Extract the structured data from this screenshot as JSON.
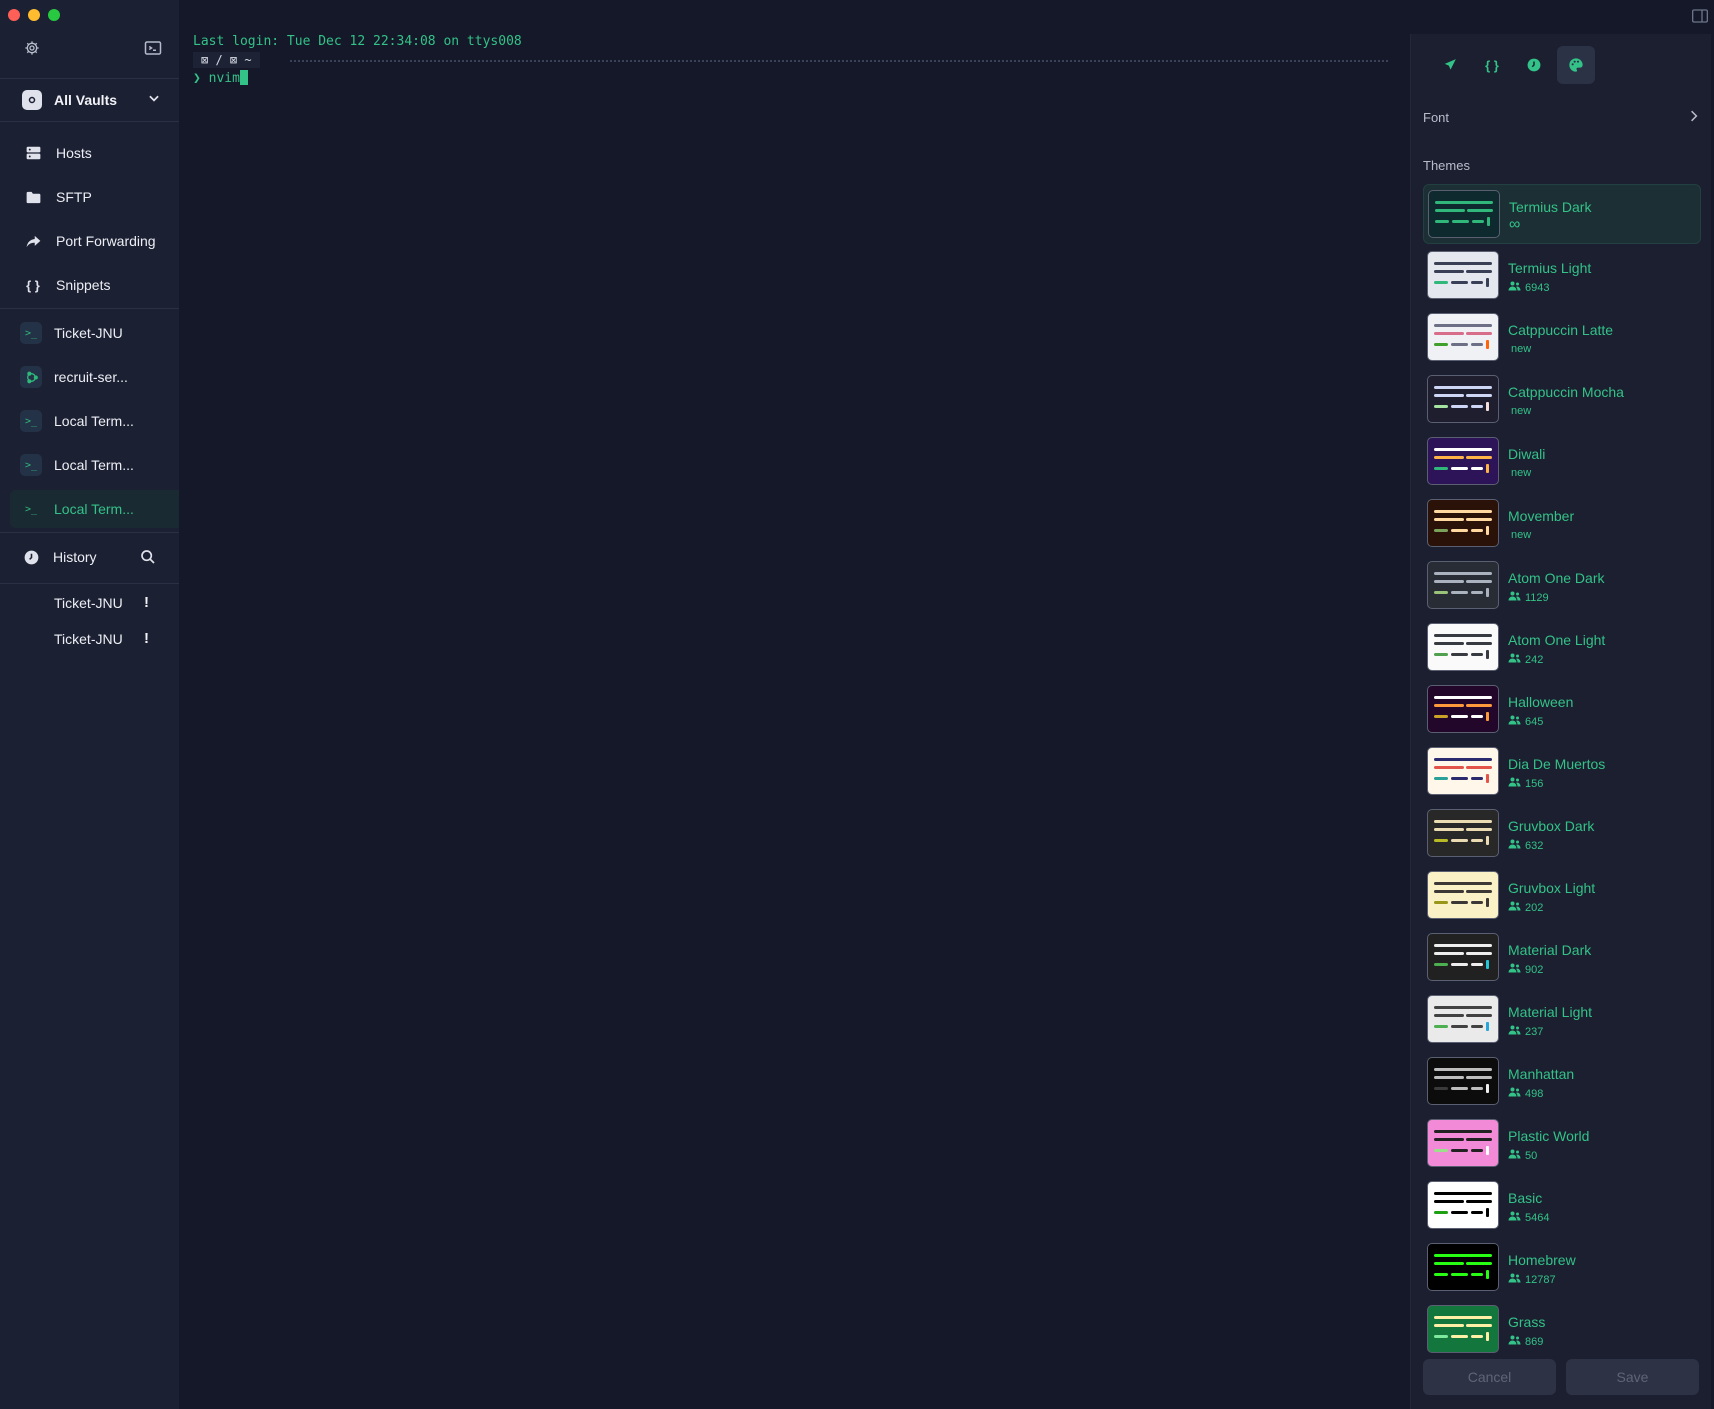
{
  "sidebar": {
    "vault_label": "All Vaults",
    "nav": [
      {
        "label": "Hosts",
        "icon": "hosts-icon"
      },
      {
        "label": "SFTP",
        "icon": "folder-icon"
      },
      {
        "label": "Port Forwarding",
        "icon": "port-forward-icon"
      },
      {
        "label": "Snippets",
        "icon": "braces-icon"
      }
    ],
    "sessions": [
      {
        "label": "Ticket-JNU",
        "icon": "terminal-icon"
      },
      {
        "label": "recruit-ser...",
        "icon": "ubuntu-icon"
      },
      {
        "label": "Local Term...",
        "icon": "terminal-icon"
      },
      {
        "label": "Local Term...",
        "icon": "terminal-icon"
      },
      {
        "label": "Local Term...",
        "icon": "terminal-icon"
      }
    ],
    "history_label": "History",
    "history_items": [
      "Ticket-JNU",
      "Ticket-JNU"
    ],
    "history_badge": "!"
  },
  "terminal": {
    "last_login": "Last login: Tue Dec 12 22:34:08 on ttys008",
    "prompt_path": "⊠ / ⊠ ~",
    "prompt_symbol": "❯",
    "command": "nvim"
  },
  "panel": {
    "tabs": [
      "rocket-icon",
      "braces-icon",
      "clock-icon",
      "palette-icon"
    ],
    "font_label": "Font",
    "themes_title": "Themes",
    "themes": [
      {
        "name": "Termius Dark",
        "meta": "∞",
        "users": false,
        "bg": "#0f2a2e",
        "l1": "#2fb87a",
        "l2": "#2fb87a",
        "l3": "#2fb87a",
        "accent": "#2fb87a"
      },
      {
        "name": "Termius Light",
        "meta": "6943",
        "users": true,
        "bg": "#e4e7ee",
        "l1": "#394056",
        "l2": "#394056",
        "l3": "#2fb87a",
        "accent": "#394056"
      },
      {
        "name": "Catppuccin Latte",
        "meta": "new",
        "users": false,
        "bg": "#eff1f5",
        "l1": "#6c6f85",
        "l2": "#d86d8a",
        "l3": "#40a02b",
        "accent": "#fe640b"
      },
      {
        "name": "Catppuccin Mocha",
        "meta": "new",
        "users": false,
        "bg": "#1e1e2e",
        "l1": "#cdd6f4",
        "l2": "#cdd6f4",
        "l3": "#a6e3a1",
        "accent": "#f5e0dc"
      },
      {
        "name": "Diwali",
        "meta": "new",
        "users": false,
        "bg": "#2d1357",
        "l1": "#ffffff",
        "l2": "#ffb347",
        "l3": "#2fb87a",
        "accent": "#ffb347"
      },
      {
        "name": "Movember",
        "meta": "new",
        "users": false,
        "bg": "#2a1208",
        "l1": "#ffd9a0",
        "l2": "#ffd9a0",
        "l3": "#7ba25b",
        "accent": "#ffd9a0"
      },
      {
        "name": "Atom One Dark",
        "meta": "1129",
        "users": true,
        "bg": "#282c34",
        "l1": "#abb2bf",
        "l2": "#abb2bf",
        "l3": "#98c379",
        "accent": "#abb2bf"
      },
      {
        "name": "Atom One Light",
        "meta": "242",
        "users": true,
        "bg": "#fafafa",
        "l1": "#383a42",
        "l2": "#383a42",
        "l3": "#50a14f",
        "accent": "#383a42"
      },
      {
        "name": "Halloween",
        "meta": "645",
        "users": true,
        "bg": "#22072a",
        "l1": "#ffffff",
        "l2": "#ff9a3c",
        "l3": "#c9a227",
        "accent": "#ff9a3c"
      },
      {
        "name": "Dia De Muertos",
        "meta": "156",
        "users": true,
        "bg": "#fff7ea",
        "l1": "#2b2a6e",
        "l2": "#e2534a",
        "l3": "#2aa198",
        "accent": "#e2534a"
      },
      {
        "name": "Gruvbox Dark",
        "meta": "632",
        "users": true,
        "bg": "#282828",
        "l1": "#ebdbb2",
        "l2": "#ebdbb2",
        "l3": "#b8bb26",
        "accent": "#ebdbb2"
      },
      {
        "name": "Gruvbox Light",
        "meta": "202",
        "users": true,
        "bg": "#fbf1c7",
        "l1": "#3c3836",
        "l2": "#3c3836",
        "l3": "#98971a",
        "accent": "#3c3836"
      },
      {
        "name": "Material Dark",
        "meta": "902",
        "users": true,
        "bg": "#212121",
        "l1": "#eeeeee",
        "l2": "#eeeeee",
        "l3": "#4caf50",
        "accent": "#26c6da"
      },
      {
        "name": "Material Light",
        "meta": "237",
        "users": true,
        "bg": "#eaeaea",
        "l1": "#424242",
        "l2": "#424242",
        "l3": "#4caf50",
        "accent": "#26a6d9"
      },
      {
        "name": "Manhattan",
        "meta": "498",
        "users": true,
        "bg": "#0c0c0c",
        "l1": "#bdbdbd",
        "l2": "#bdbdbd",
        "l3": "#3a3a3a",
        "accent": "#eeeeee"
      },
      {
        "name": "Plastic World",
        "meta": "50",
        "users": true,
        "bg": "#f28ad8",
        "l1": "#222222",
        "l2": "#222222",
        "l3": "#9be08a",
        "accent": "#ffffff"
      },
      {
        "name": "Basic",
        "meta": "5464",
        "users": true,
        "bg": "#ffffff",
        "l1": "#000000",
        "l2": "#000000",
        "l3": "#1ea013",
        "accent": "#000000"
      },
      {
        "name": "Homebrew",
        "meta": "12787",
        "users": true,
        "bg": "#000000",
        "l1": "#28fe14",
        "l2": "#28fe14",
        "l3": "#28fe14",
        "accent": "#28fe14"
      },
      {
        "name": "Grass",
        "meta": "869",
        "users": true,
        "bg": "#13773d",
        "l1": "#fff0a5",
        "l2": "#fff0a5",
        "l3": "#7ee89c",
        "accent": "#fff0a5"
      }
    ],
    "cancel_label": "Cancel",
    "save_label": "Save"
  },
  "colors": {
    "accent": "#33c287",
    "sidebar_bg": "#1c2033",
    "terminal_bg": "#141829",
    "panel_bg": "#1b1f30"
  }
}
